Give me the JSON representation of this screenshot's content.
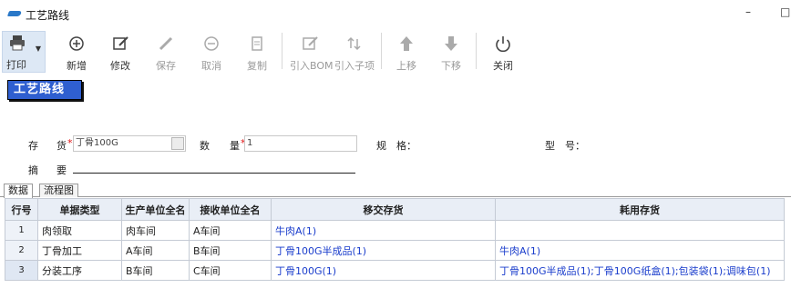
{
  "window": {
    "title": "工艺路线",
    "minimize_glyph": "–",
    "maximize_glyph": "□"
  },
  "toolbar": {
    "print": "打印",
    "add": "新增",
    "edit": "修改",
    "save": "保存",
    "cancel": "取消",
    "copy": "复制",
    "import_bom": "引入BOM",
    "import_sub": "引入子项",
    "move_up": "上移",
    "move_down": "下移",
    "close": "关闭"
  },
  "page": {
    "section_title": "工艺路线"
  },
  "form": {
    "inventory_label_a": "存",
    "inventory_label_b": "货",
    "inventory_value": "丁骨100G",
    "quantity_label_a": "数",
    "quantity_label_b": "量",
    "quantity_value": "1",
    "required_mark": "*",
    "spec_label": "规　格：",
    "model_label": "型　号：",
    "summary_label_a": "摘",
    "summary_label_b": "要"
  },
  "tabs": [
    {
      "label": "数据",
      "active": true
    },
    {
      "label": "流程图",
      "active": false
    }
  ],
  "grid": {
    "columns": [
      "行号",
      "单据类型",
      "生产单位全名",
      "接收单位全名",
      "移交存货",
      "耗用存货"
    ],
    "rows": [
      {
        "no": "1",
        "doc_type": "肉领取",
        "prod_unit": "肉车间",
        "recv_unit": "A车间",
        "transfer": "牛肉A(1)",
        "consume": ""
      },
      {
        "no": "2",
        "doc_type": "丁骨加工",
        "prod_unit": "A车间",
        "recv_unit": "B车间",
        "transfer": "丁骨100G半成品(1)",
        "consume": "牛肉A(1)"
      },
      {
        "no": "3",
        "doc_type": "分装工序",
        "prod_unit": "B车间",
        "recv_unit": "C车间",
        "transfer": "丁骨100G(1)",
        "consume": "丁骨100G半成品(1);丁骨100G纸盒(1);包装袋(1);调味包(1)"
      }
    ]
  },
  "colors": {
    "accent": "#2f5fd0",
    "link": "#1a3dcc",
    "required": "#e01010"
  }
}
